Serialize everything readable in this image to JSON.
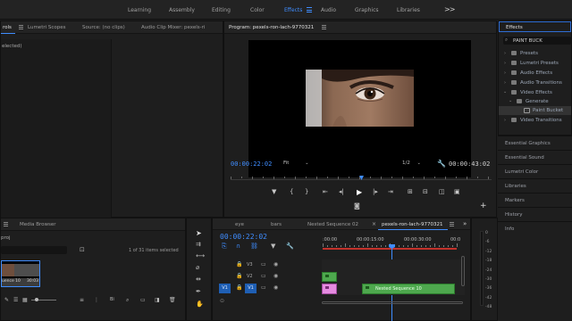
{
  "workspaces": {
    "tabs": [
      {
        "label": "Learning"
      },
      {
        "label": "Assembly"
      },
      {
        "label": "Editing"
      },
      {
        "label": "Color"
      },
      {
        "label": "Effects",
        "active": true
      },
      {
        "label": "Audio"
      },
      {
        "label": "Graphics"
      },
      {
        "label": "Libraries"
      }
    ],
    "overflow": ">>"
  },
  "source_panel": {
    "tabs": [
      "rols",
      "Lumetri Scopes",
      "Source: (no clips)",
      "Audio Clip Mixer: pexels-ri"
    ],
    "active_tab": "rols",
    "body_text": "elected)"
  },
  "program_monitor": {
    "title": "Program: pexels-ron-lach-9770321",
    "timecode_current": "00:00:22:02",
    "fit": "Fit",
    "resolution": "1/2",
    "timecode_duration": "00:00:43:02"
  },
  "effects_panel": {
    "tab": "Effects",
    "search_value": "PAINT BUCK",
    "tree": [
      {
        "label": "Presets",
        "level": 0
      },
      {
        "label": "Lumetri Presets",
        "level": 0
      },
      {
        "label": "Audio Effects",
        "level": 0
      },
      {
        "label": "Audio Transitions",
        "level": 0
      },
      {
        "label": "Video Effects",
        "level": 0,
        "expanded": true
      },
      {
        "label": "Generate",
        "level": 1,
        "expanded": true
      },
      {
        "label": "Paint Bucket",
        "level": 2,
        "selected": true
      },
      {
        "label": "Video Transitions",
        "level": 0
      }
    ]
  },
  "side_panels": [
    "Essential Graphics",
    "Essential Sound",
    "Lumetri Color",
    "Libraries",
    "Markers",
    "History",
    "Info"
  ],
  "project_panel": {
    "tabs": [
      "Media Browser"
    ],
    "project_name": "proj",
    "items_selected": "1 of 31 items selected",
    "thumb_label": "uence 10",
    "thumb_duration": "30:03",
    "bin_label": "Bi"
  },
  "timeline": {
    "tabs": [
      "eye",
      "bars",
      "Nested Sequence 02",
      "pexels-ron-lach-9770321"
    ],
    "active_tab": "pexels-ron-lach-9770321",
    "timecode": "00:00:22:02",
    "ruler": [
      ":00:00",
      "00:00:15:00",
      "00:00:30:00",
      "00:0"
    ],
    "tracks": [
      {
        "label": "V3"
      },
      {
        "label": "V2"
      },
      {
        "label": "V1"
      }
    ],
    "source_patch": "V1",
    "clip_label": "Nested Sequence 10",
    "playhead_fraction": 0.52
  },
  "audio_meter": {
    "labels": [
      "0",
      "-6",
      "-12",
      "-18",
      "-24",
      "-30",
      "-36",
      "-42",
      "-48"
    ]
  },
  "colors": {
    "accent": "#3f8dff",
    "clip_green": "#4ea84e",
    "clip_pink": "#e58be0",
    "in_out_red": "#c4322b"
  }
}
